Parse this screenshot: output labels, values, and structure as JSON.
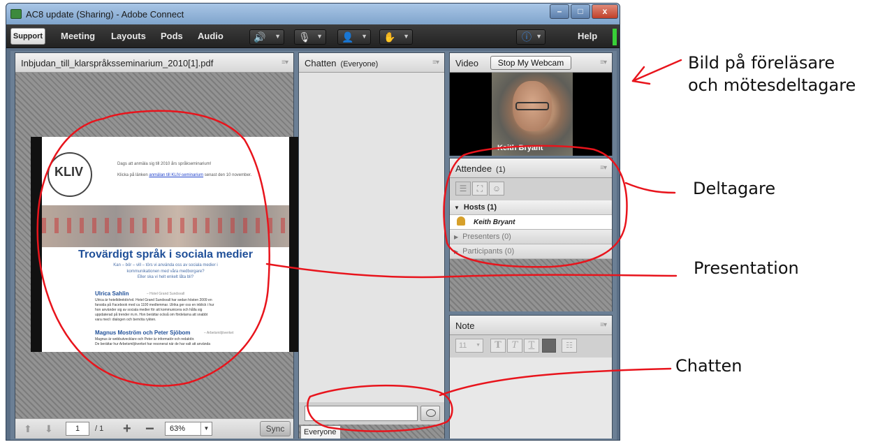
{
  "window": {
    "title": "AC8 update (Sharing) - Adobe Connect",
    "min_glyph": "–",
    "max_glyph": "□",
    "close_glyph": "x"
  },
  "menubar": {
    "logo": "Support",
    "items": [
      "Meeting",
      "Layouts",
      "Pods",
      "Audio"
    ],
    "help": "Help",
    "toolbar_icons": [
      "speaker-icon",
      "microphone-icon",
      "webcam-icon",
      "raise-hand-icon",
      "info-icon"
    ],
    "colors": {
      "accent_green": "#38d038",
      "speaker_green": "#3ad13a"
    }
  },
  "share_pod": {
    "title": "Inbjudan_till_klarspråksseminarium_2010[1].pdf",
    "document": {
      "seal_text": "KLIV",
      "invite": "Dags att anmäla sig till 2010 års språkseminarium!",
      "link_prefix": "Klicka på länken",
      "link_text": "anmälan till KLIV-seminarium",
      "link_suffix": "senast den 10 november.",
      "heading": "Trovärdigt språk i sociala medier",
      "sub1": "Kan – bör – vill – törs vi använda oss av sociala medier i",
      "sub2": "kommunikationen med våra medborgare?",
      "sub3": "Eller ska vi helt enkelt låta bli?",
      "speaker1": "Ulrica Sahlin",
      "speaker1_role": "– Hotel Grand Sundsvall",
      "speaker1_text": [
        "Ulrica är hotelldirektör/vd. Hotel Grand Sundsvall har sedan hösten 2009 en",
        "fansida på Facebook med ca 1100 medlemmar. Ulrika ger oss en inblick i hur",
        "hon använder sig av sociala medier för att kommunicera och hålla sig",
        "uppdaterad på trender m.m. Hon berättar också om fördelarna att snabbt",
        "vara med i dialogen och bemöta rykten."
      ],
      "speaker2": "Magnus Moström och Peter Sjöbom",
      "speaker2_role": "– Arbetsmiljöverket",
      "speaker2_text": [
        "Magnus är webbutvecklare och Peter är informatör och redaktör.",
        "De berättar hur Arbetsmiljöverket har resonerat när de har valt att använda"
      ]
    },
    "footer": {
      "page": "1",
      "page_total": "/ 1",
      "zoom": "63%",
      "sync": "Sync"
    }
  },
  "chat_pod": {
    "title": "Chatten",
    "scope": "(Everyone)",
    "input_placeholder": "",
    "tab": "Everyone"
  },
  "video_pod": {
    "title": "Video",
    "stop_button": "Stop My Webcam",
    "participant_name": "Keith Bryant"
  },
  "attendee_pod": {
    "title": "Attendee",
    "count": "(1)",
    "hosts": "Hosts (1)",
    "host_user": "Keith Bryant",
    "presenters": "Presenters (0)",
    "participants": "Participants (0)"
  },
  "note_pod": {
    "title": "Note",
    "font_size": "11"
  },
  "annotations": {
    "video_label_line1": "Bild på föreläsare",
    "video_label_line2": "och mötesdeltagare",
    "attendee_label": "Deltagare",
    "presentation_label": "Presentation",
    "chat_label": "Chatten",
    "ink_color": "#e8141c"
  }
}
